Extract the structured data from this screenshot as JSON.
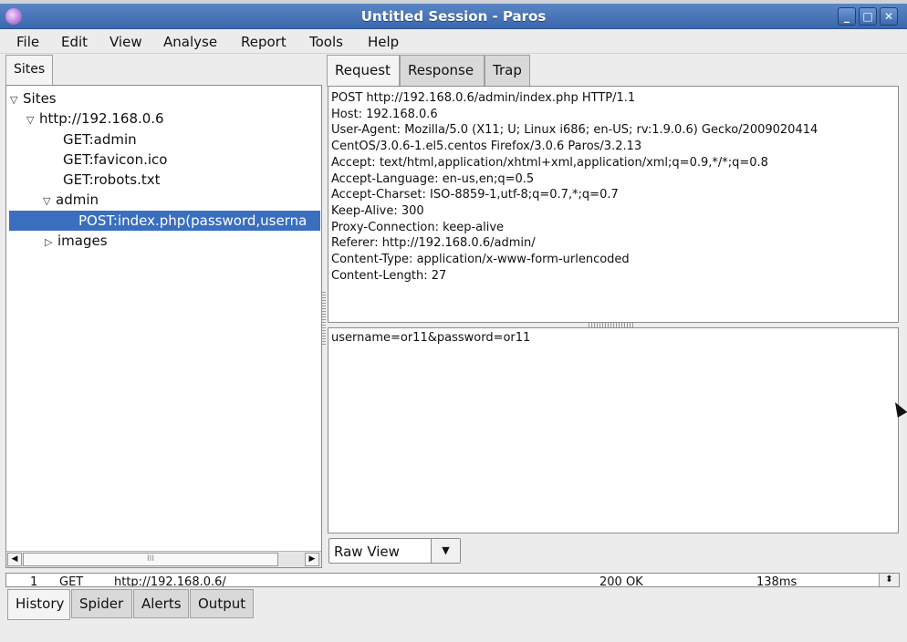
{
  "window": {
    "title": "Untitled Session - Paros"
  },
  "menu": [
    "File",
    "Edit",
    "View",
    "Analyse",
    "Report",
    "Tools",
    "Help"
  ],
  "left_pane": {
    "tab_label": "Sites",
    "tree": [
      {
        "label": "Sites",
        "expanded": true
      },
      {
        "label": "http://192.168.0.6",
        "expanded": true
      },
      {
        "label": "GET:admin"
      },
      {
        "label": "GET:favicon.ico"
      },
      {
        "label": "GET:robots.txt"
      },
      {
        "label": "admin",
        "expanded": true
      },
      {
        "label": "POST:index.php(password,userna",
        "selected": true
      },
      {
        "label": "images",
        "expanded": false
      }
    ],
    "scroll_thumb_label": "III"
  },
  "right_pane": {
    "tabs": [
      "Request",
      "Response",
      "Trap"
    ],
    "active_tab": "Request",
    "request_header_lines": [
      "POST http://192.168.0.6/admin/index.php HTTP/1.1",
      "Host: 192.168.0.6",
      "User-Agent: Mozilla/5.0 (X11; U; Linux i686; en-US; rv:1.9.0.6) Gecko/2009020414",
      "CentOS/3.0.6-1.el5.centos Firefox/3.0.6 Paros/3.2.13",
      "Accept: text/html,application/xhtml+xml,application/xml;q=0.9,*/*;q=0.8",
      "Accept-Language: en-us,en;q=0.5",
      "Accept-Charset: ISO-8859-1,utf-8;q=0.7,*;q=0.7",
      "Keep-Alive: 300",
      "Proxy-Connection: keep-alive",
      "Referer: http://192.168.0.6/admin/",
      "Content-Type: application/x-www-form-urlencoded",
      "Content-Length: 27"
    ],
    "request_body": "username=or11&password=or11",
    "view_select": "Raw View"
  },
  "history": {
    "row": {
      "index": "1",
      "method": "GET",
      "url": "http://192.168.0.6/",
      "status": "200 OK",
      "time": "138ms"
    }
  },
  "bottom_tabs": [
    "History",
    "Spider",
    "Alerts",
    "Output"
  ],
  "active_bottom_tab": "History"
}
